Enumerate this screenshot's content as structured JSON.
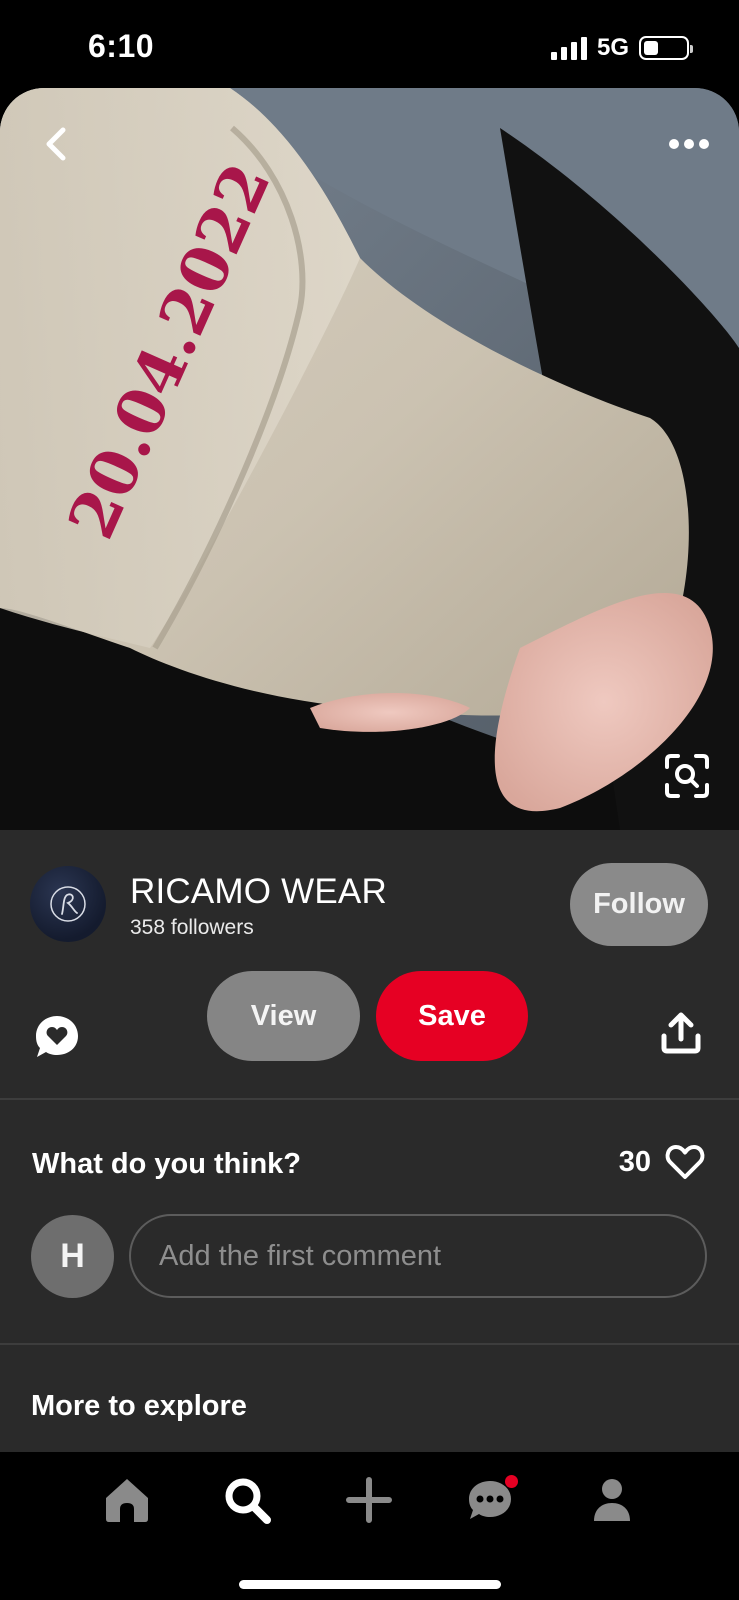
{
  "status_bar": {
    "time": "6:10",
    "network": "5G",
    "signal_bars": 4,
    "battery_level": 0.35
  },
  "pin": {
    "image_icons": [
      "back-chevron-icon",
      "more-options-icon",
      "visual-search-icon"
    ],
    "embroidery_text": "20.04.2022"
  },
  "creator": {
    "name": "RICAMO WEAR",
    "followers": "358 followers",
    "follow_label": "Follow"
  },
  "actions": {
    "view_label": "View",
    "save_label": "Save",
    "comment_icon": "comment-heart-icon",
    "share_icon": "share-icon"
  },
  "comments": {
    "prompt": "What do you think?",
    "like_count": "30",
    "user_initial": "H",
    "placeholder": "Add the first comment"
  },
  "more": {
    "title": "More to explore"
  },
  "nav": {
    "items": [
      "home-icon",
      "search-icon",
      "create-icon",
      "messages-icon",
      "profile-icon"
    ],
    "active": "search-icon"
  },
  "colors": {
    "save": "#e60023",
    "panel": "#2a2a2a",
    "follow": "#8a8a8a",
    "view": "#858585",
    "badge": "#e60023"
  }
}
